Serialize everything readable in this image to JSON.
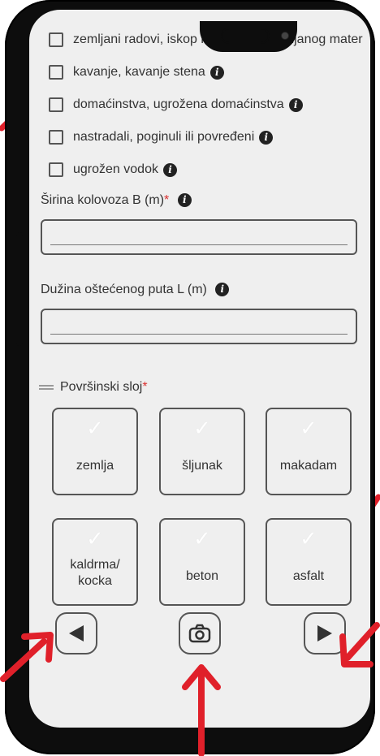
{
  "checkboxes": [
    {
      "label": "zemljani radovi, iskop i nasipanje zemljanog mater",
      "info": false
    },
    {
      "label": "kavanje, kavanje stena",
      "info": true
    },
    {
      "label": "domaćinstva, ugrožena domaćinstva",
      "info": true
    },
    {
      "label": "nastradali, poginuli ili povređeni",
      "info": true
    },
    {
      "label": "ugrožen vodok",
      "info": true
    }
  ],
  "fields": {
    "width": {
      "label": "Širina kolovoza B (m)",
      "required_mark": "*",
      "value": ""
    },
    "length": {
      "label": "Dužina oštećenog puta L (m)",
      "value": ""
    }
  },
  "surface": {
    "title": "Površinski sloj",
    "required_mark": "*",
    "options": [
      "zemlja",
      "šljunak",
      "makadam",
      "kaldrma/\nkocka",
      "beton",
      "asfalt"
    ]
  },
  "icons": {
    "info": "info-icon",
    "check": "check-icon",
    "back": "arrow-left-icon",
    "camera": "camera-icon",
    "next": "arrow-right-icon"
  },
  "colors": {
    "required": "#d9302f",
    "annotation": "#e0202a",
    "screen": "#efefef"
  }
}
